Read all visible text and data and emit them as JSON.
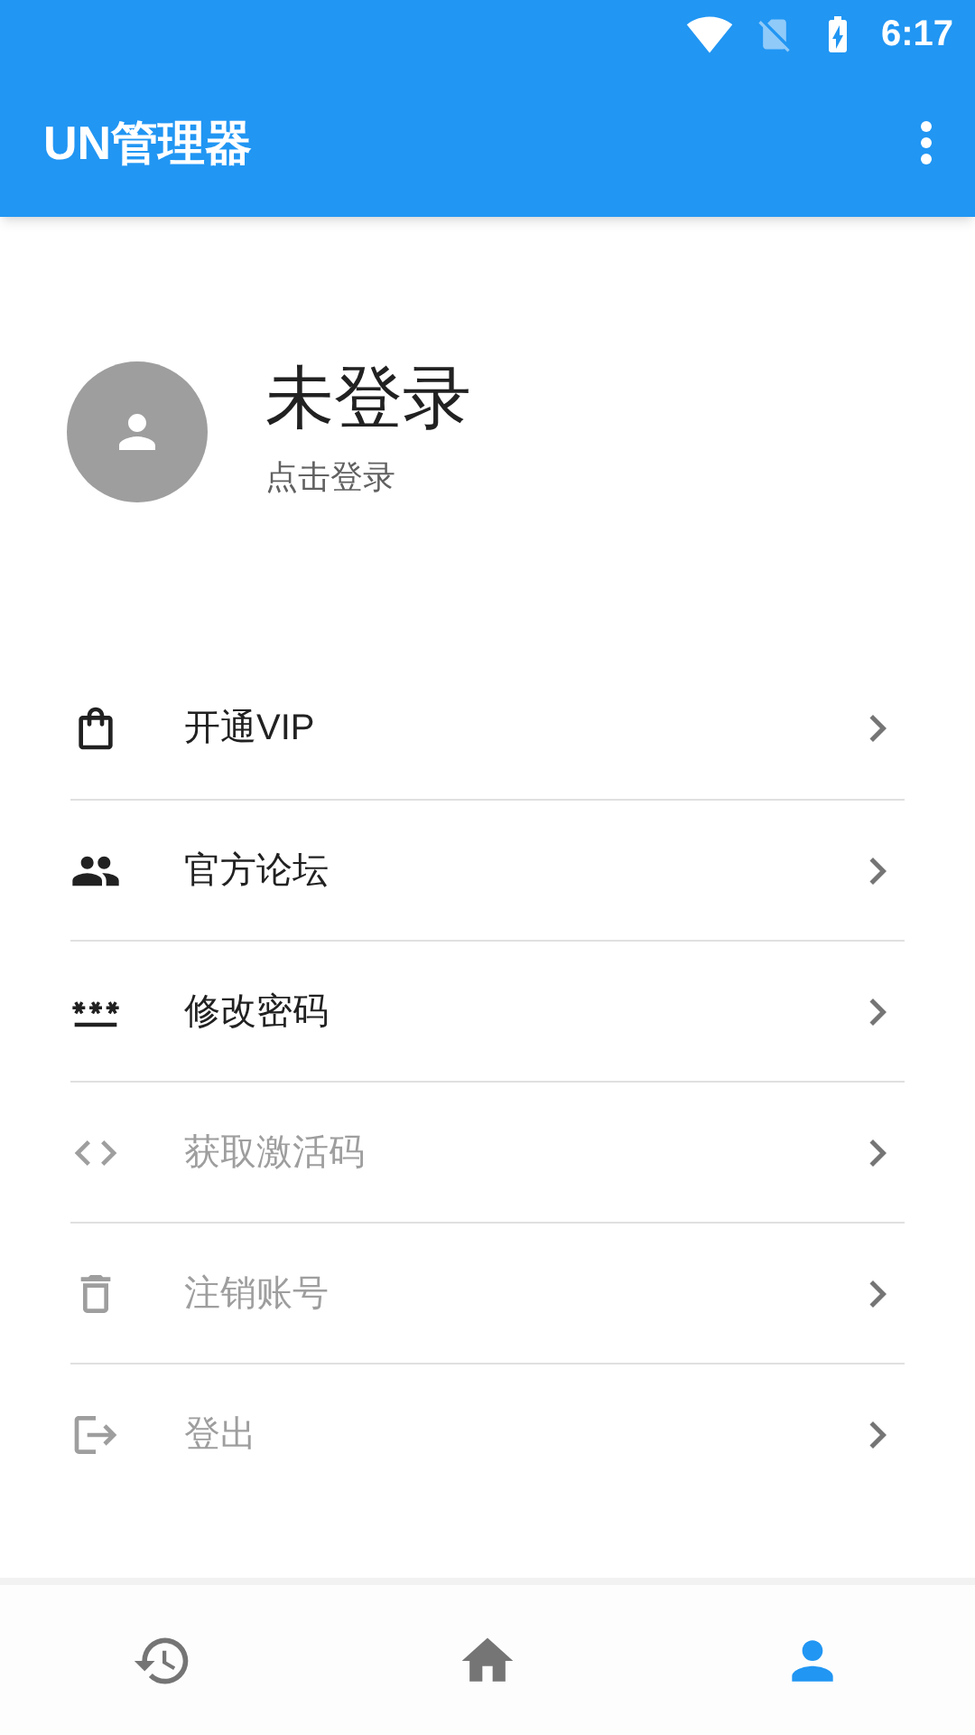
{
  "status_bar": {
    "time": "6:17"
  },
  "app_bar": {
    "title": "UN管理器"
  },
  "profile": {
    "name": "未登录",
    "hint": "点击登录"
  },
  "menu": [
    {
      "kind": "vip",
      "label": "开通VIP",
      "disabled": false
    },
    {
      "kind": "forum",
      "label": "官方论坛",
      "disabled": false
    },
    {
      "kind": "password",
      "label": "修改密码",
      "disabled": false
    },
    {
      "kind": "code",
      "label": "获取激活码",
      "disabled": true
    },
    {
      "kind": "delete",
      "label": "注销账号",
      "disabled": true
    },
    {
      "kind": "logout",
      "label": "登出",
      "disabled": true
    }
  ],
  "bottom_nav": [
    {
      "kind": "history",
      "selected": false
    },
    {
      "kind": "home",
      "selected": false
    },
    {
      "kind": "profile",
      "selected": true
    }
  ]
}
